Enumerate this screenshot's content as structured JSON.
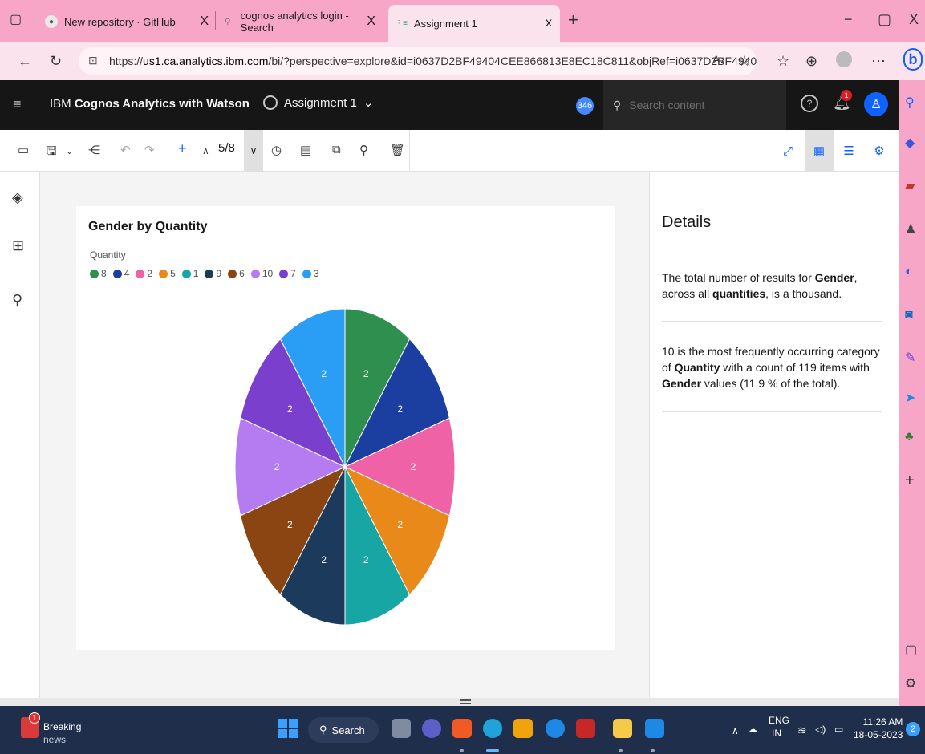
{
  "browser": {
    "tabs": [
      {
        "label": "New repository · GitHub",
        "close": "X"
      },
      {
        "label": "cognos analytics login - Search",
        "close": "X"
      },
      {
        "label": "Assignment 1",
        "close": "x"
      }
    ],
    "new_tab": "+",
    "url_prefix": "https://",
    "url_host": "us1.ca.analytics.ibm.com",
    "url_rest": "/bi/?perspective=explore&id=i0637D2BF49404CEE866813E8EC18C811&objRef=i0637D2BF49404C...",
    "window_controls": {
      "minimize": "−",
      "maximize": "▢",
      "close": "X"
    }
  },
  "app": {
    "brand_prefix": "IBM",
    "brand_name": "Cognos Analytics with Watson",
    "asset_title": "Assignment 1",
    "count_badge": "346",
    "search_placeholder": "Search content",
    "notification_count": "1"
  },
  "toolbar": {
    "page_indicator": "5/8"
  },
  "chart": {
    "title": "Gender by Quantity",
    "legend_title": "Quantity"
  },
  "chart_data": {
    "type": "pie",
    "title": "Gender by Quantity",
    "legend_title": "Quantity",
    "legend": [
      {
        "label": "8",
        "color": "#2f8f4e"
      },
      {
        "label": "4",
        "color": "#1a3fa0"
      },
      {
        "label": "2",
        "color": "#f062a6"
      },
      {
        "label": "5",
        "color": "#e8891a"
      },
      {
        "label": "1",
        "color": "#17a6a3"
      },
      {
        "label": "9",
        "color": "#1b3a5c"
      },
      {
        "label": "6",
        "color": "#8a4513"
      },
      {
        "label": "10",
        "color": "#b57bf0"
      },
      {
        "label": "7",
        "color": "#7a3fcc"
      },
      {
        "label": "3",
        "color": "#2a9df4"
      }
    ],
    "slices": [
      {
        "category": "8",
        "value": 2,
        "label": "2",
        "color": "#2f8f4e"
      },
      {
        "category": "4",
        "value": 2,
        "label": "2",
        "color": "#1a3fa0"
      },
      {
        "category": "2",
        "value": 2,
        "label": "2",
        "color": "#f062a6"
      },
      {
        "category": "5",
        "value": 2,
        "label": "2",
        "color": "#e8891a"
      },
      {
        "category": "1",
        "value": 2,
        "label": "2",
        "color": "#17a6a3"
      },
      {
        "category": "9",
        "value": 2,
        "label": "2",
        "color": "#1b3a5c"
      },
      {
        "category": "6",
        "value": 2,
        "label": "2",
        "color": "#8a4513"
      },
      {
        "category": "10",
        "value": 2,
        "label": "2",
        "color": "#b57bf0"
      },
      {
        "category": "7",
        "value": 2,
        "label": "2",
        "color": "#7a3fcc"
      },
      {
        "category": "3",
        "value": 2,
        "label": "2",
        "color": "#2a9df4"
      }
    ]
  },
  "details": {
    "title": "Details",
    "insight1": {
      "text1": "The total number of results for ",
      "bold1": "Gender",
      "text2": ", across all ",
      "bold2": "quantities",
      "text3": ", is a thousand."
    },
    "insight2": {
      "text1": "10 is the most frequently occurring category of ",
      "bold1": "Quantity",
      "text2": " with a count of 119 items with ",
      "bold2": "Gender",
      "text3": " values (11.9 % of the total)."
    }
  },
  "taskbar": {
    "news_badge": "1",
    "news_line1": "Breaking",
    "news_line2": "news",
    "search_label": "Search",
    "lang_line1": "ENG",
    "lang_line2": "IN",
    "time": "11:26 AM",
    "date": "18-05-2023",
    "notification_count": "2"
  }
}
